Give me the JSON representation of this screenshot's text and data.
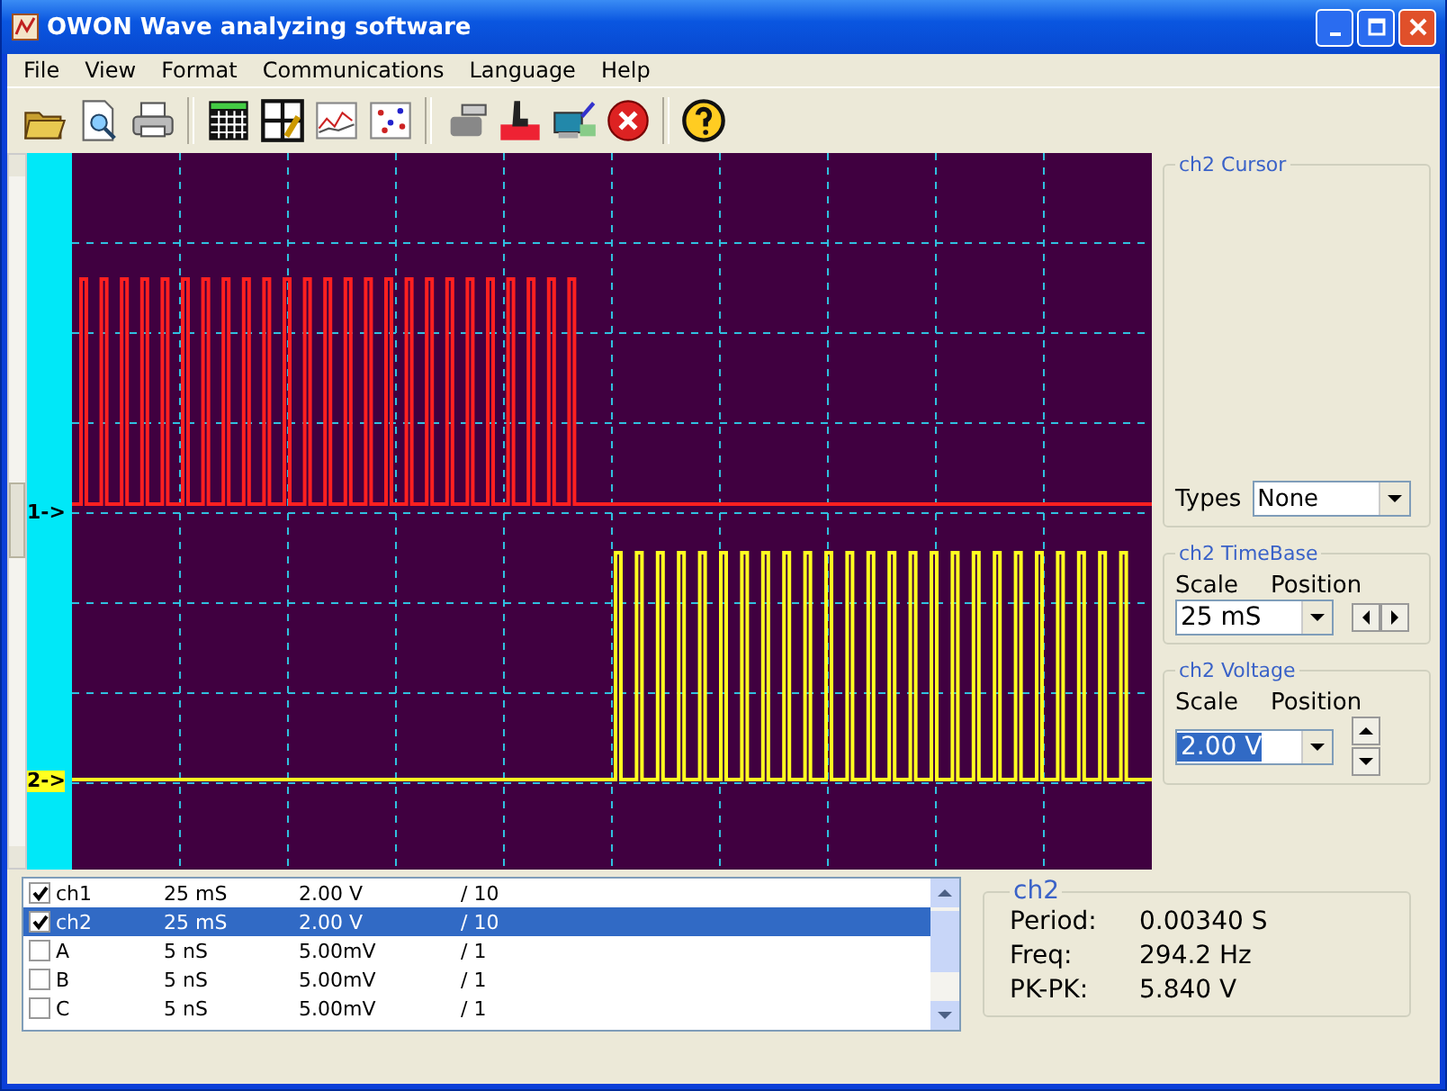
{
  "window": {
    "title": "OWON Wave analyzing software"
  },
  "menu": [
    "File",
    "View",
    "Format",
    "Communications",
    "Language",
    "Help"
  ],
  "markers": [
    {
      "kind": "ch1",
      "label": "1->"
    },
    {
      "kind": "ch2",
      "label": "2->"
    }
  ],
  "cursor": {
    "title": "ch2 Cursor",
    "types_label": "Types",
    "types_value": "None"
  },
  "timebase": {
    "title": "ch2  TimeBase",
    "scale_label": "Scale",
    "position_label": "Position",
    "scale_value": "25 mS"
  },
  "voltage": {
    "title": "ch2  Voltage",
    "scale_label": "Scale",
    "position_label": "Position",
    "scale_value": "2.00 V"
  },
  "channels": [
    {
      "name": "ch1",
      "time": "25 mS",
      "volts": "2.00 V",
      "ratio": "/ 10",
      "checked": true,
      "selected": false
    },
    {
      "name": "ch2",
      "time": "25 mS",
      "volts": "2.00 V",
      "ratio": "/ 10",
      "checked": true,
      "selected": true
    },
    {
      "name": "A",
      "time": "5  nS",
      "volts": "5.00mV",
      "ratio": "/ 1",
      "checked": false,
      "selected": false
    },
    {
      "name": "B",
      "time": "5  nS",
      "volts": "5.00mV",
      "ratio": "/ 1",
      "checked": false,
      "selected": false
    },
    {
      "name": "C",
      "time": "5  nS",
      "volts": "5.00mV",
      "ratio": "/ 1",
      "checked": false,
      "selected": false
    }
  ],
  "measure": {
    "title": "ch2",
    "rows": [
      {
        "label": "Period:",
        "value": "0.00340 S"
      },
      {
        "label": "Freq:",
        "value": "294.2 Hz"
      },
      {
        "label": "PK-PK:",
        "value": "5.840 V"
      }
    ]
  }
}
